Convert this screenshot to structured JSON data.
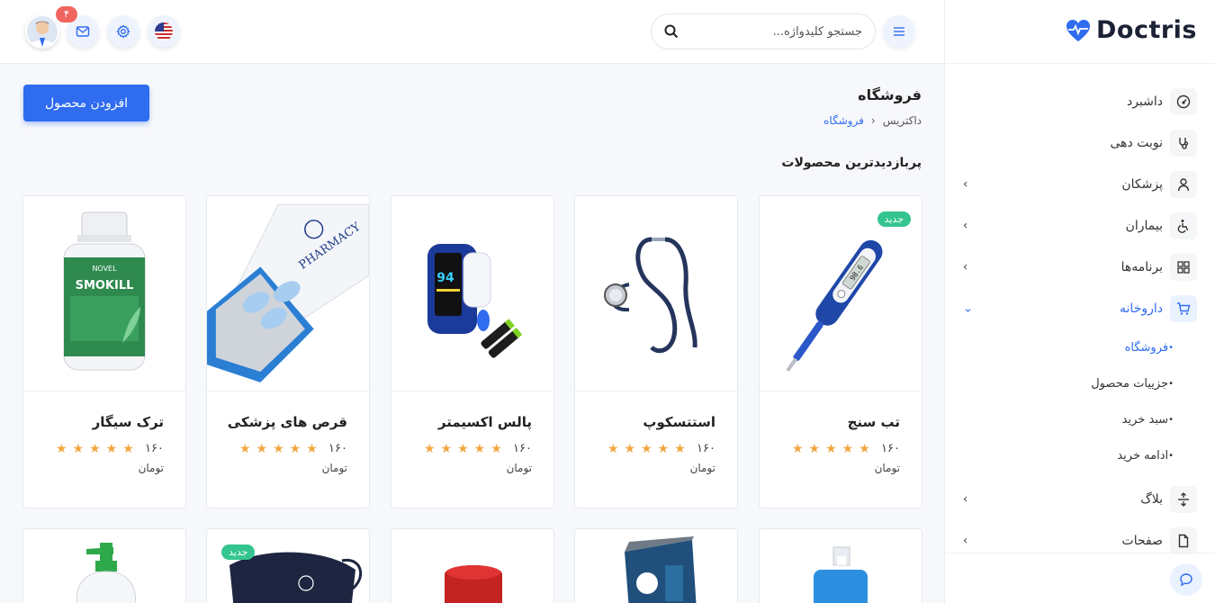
{
  "brand": {
    "name": "Doctris"
  },
  "sidebar": {
    "items": [
      {
        "label": "داشبرد",
        "icon": "dashboard-icon"
      },
      {
        "label": "نوبت دهی",
        "icon": "stethoscope-icon"
      },
      {
        "label": "پزشکان",
        "icon": "user-icon"
      },
      {
        "label": "بیماران",
        "icon": "wheelchair-icon"
      },
      {
        "label": "برنامه‌ها",
        "icon": "apps-grid-icon"
      },
      {
        "label": "داروخانه",
        "icon": "cart-icon"
      }
    ],
    "pharmacy_sub": [
      {
        "label": "فروشگاه"
      },
      {
        "label": "جزییات محصول"
      },
      {
        "label": "سبد خرید"
      },
      {
        "label": "ادامه خرید"
      }
    ],
    "items_bottom": [
      {
        "label": "بلاگ",
        "icon": "blog-icon"
      },
      {
        "label": "صفحات",
        "icon": "file-icon"
      }
    ]
  },
  "header": {
    "search_placeholder": "جستجو کلیدواژه...",
    "notification_count": "۴"
  },
  "page": {
    "title": "فروشگاه",
    "breadcrumb": [
      "داکتریس",
      "فروشگاه"
    ],
    "add_button": "افزودن محصول",
    "section_title": "پربازدیدترین محصولات"
  },
  "products": [
    {
      "name": "تب سنج",
      "price": "۱۶۰",
      "unit": "تومان",
      "badge": "جدید"
    },
    {
      "name": "استتسکوپ",
      "price": "۱۶۰",
      "unit": "تومان"
    },
    {
      "name": "پالس اکسیمتر",
      "price": "۱۶۰",
      "unit": "تومان"
    },
    {
      "name": "قرص های پزشکی",
      "price": "۱۶۰",
      "unit": "تومان"
    },
    {
      "name": "ترک سیگار",
      "price": "۱۶۰",
      "unit": "تومان"
    }
  ],
  "products_row2": [
    {
      "badge": ""
    },
    {
      "badge": ""
    },
    {
      "badge": ""
    },
    {
      "badge": "جدید"
    },
    {
      "badge": ""
    }
  ],
  "product_images": {
    "p5_label": "SMOKILL",
    "p5_brand": "NOVEL",
    "p4_label": "PHARMACY",
    "p3_reading": "94",
    "p1_reading": "98.6"
  },
  "colors": {
    "accent": "#2f6cf0",
    "star": "#f2a640",
    "badge": "#33c48f",
    "notif": "#f0665f"
  }
}
